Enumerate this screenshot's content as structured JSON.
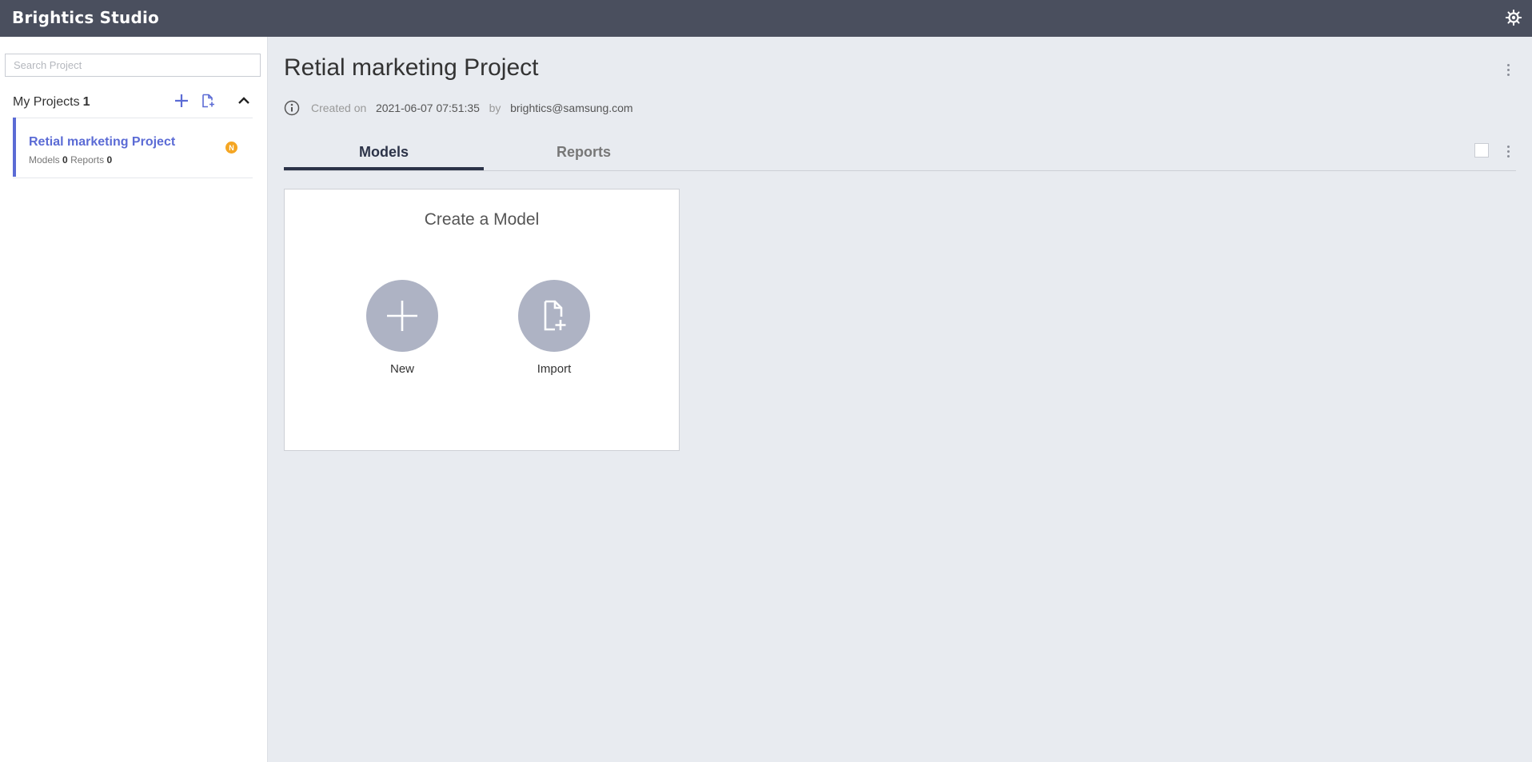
{
  "app": {
    "title": "Brightics Studio",
    "settings_icon": "gear-icon"
  },
  "sidebar": {
    "search": {
      "placeholder": "Search Project",
      "value": ""
    },
    "my_projects": {
      "label": "My Projects",
      "count": "1"
    },
    "icons": {
      "add": "plus-icon",
      "import": "import-file-icon",
      "collapse": "chevron-up-icon"
    },
    "accent_color": "#5b6bd5",
    "projects": [
      {
        "name": "Retial marketing Project",
        "models_label": "Models",
        "models_count": "0",
        "reports_label": "Reports",
        "reports_count": "0",
        "badge": "N",
        "badge_color": "#f5a623"
      }
    ]
  },
  "main": {
    "title": "Retial marketing Project",
    "meta": {
      "created_label": "Created on",
      "created_value": "2021-06-07 07:51:35",
      "by_label": "by",
      "author": "brightics@samsung.com"
    },
    "tabs": [
      {
        "label": "Models",
        "active": true
      },
      {
        "label": "Reports",
        "active": false
      }
    ],
    "create_card": {
      "title": "Create a Model",
      "new_label": "New",
      "import_label": "Import",
      "circle_color": "#aeb3c4"
    }
  },
  "colors": {
    "topbar": "#4a4f5e",
    "background": "#e8ebf0",
    "active_tab": "#2c3348"
  }
}
